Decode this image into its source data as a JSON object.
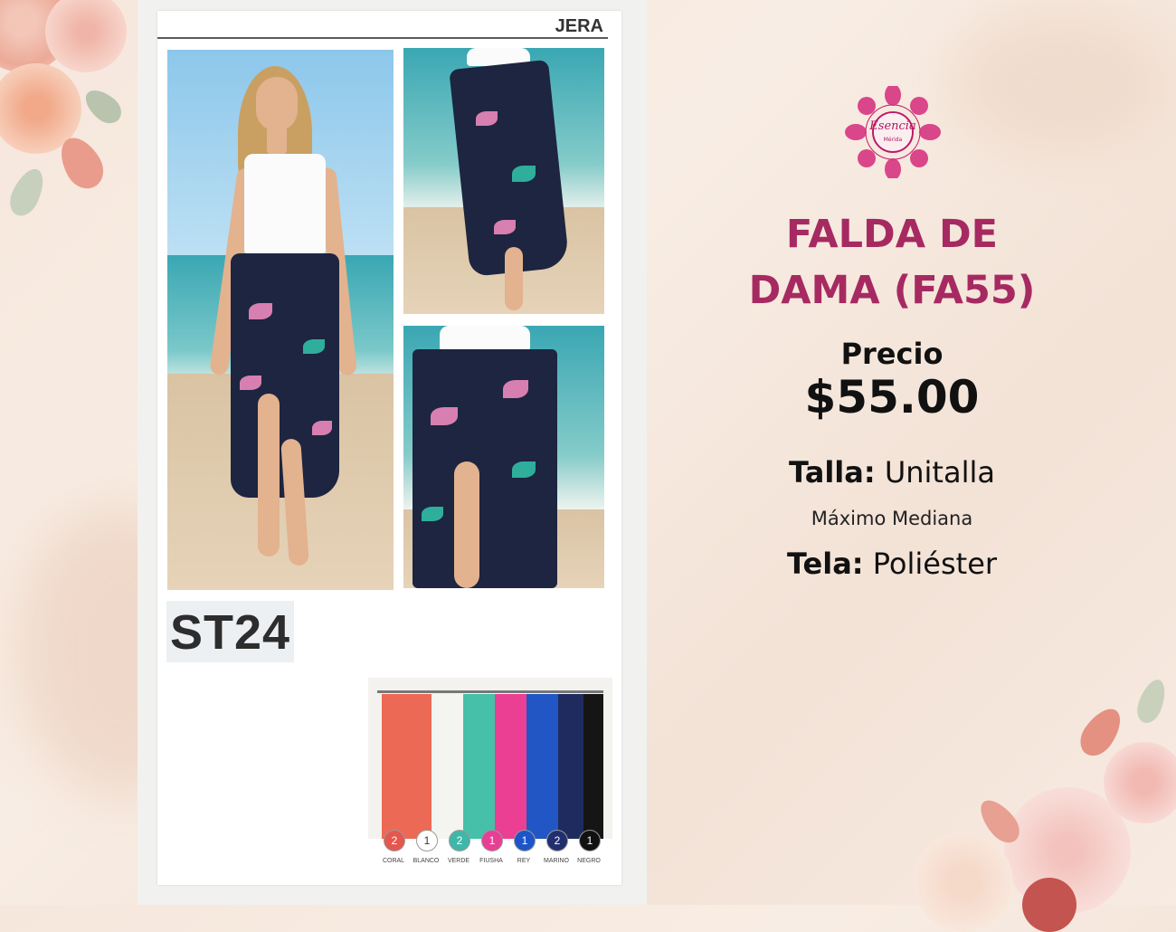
{
  "catalog": {
    "brand": "JERA",
    "model_code": "ST24",
    "colors": [
      {
        "name": "CORAL",
        "qty": "2",
        "hex": "#e4574f"
      },
      {
        "name": "BLANCO",
        "qty": "1",
        "hex": "#ffffff"
      },
      {
        "name": "VERDE",
        "qty": "2",
        "hex": "#3fb7a8"
      },
      {
        "name": "FIUSHA",
        "qty": "1",
        "hex": "#e83f95"
      },
      {
        "name": "REY",
        "qty": "1",
        "hex": "#1d55c8"
      },
      {
        "name": "MARINO",
        "qty": "2",
        "hex": "#222f6e"
      },
      {
        "name": "NEGRO",
        "qty": "1",
        "hex": "#111111"
      }
    ]
  },
  "logo": {
    "name": "Esencia",
    "subtitle": "Mérida",
    "icon": "mandala-icon"
  },
  "product": {
    "title_line1": "FALDA DE",
    "title_line2": "DAMA (FA55)",
    "price_label": "Precio",
    "price": "$55.00",
    "size_label": "Talla:",
    "size_value": "Unitalla",
    "size_note": "Máximo Mediana",
    "fabric_label": "Tela:",
    "fabric_value": "Poliéster"
  },
  "theme": {
    "accent": "#a62a61",
    "text": "#111111"
  }
}
